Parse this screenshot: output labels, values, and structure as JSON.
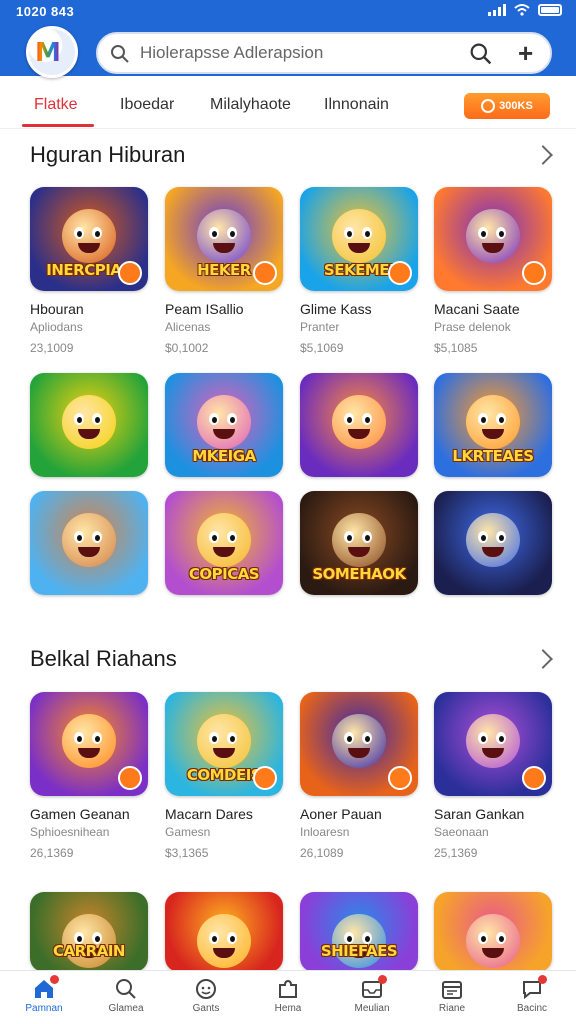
{
  "status": {
    "time": "1020 843"
  },
  "search": {
    "placeholder": "Hiolerapsse Adlerapsion"
  },
  "tabs": [
    {
      "label": "Flatke"
    },
    {
      "label": "Iboedar"
    },
    {
      "label": "Milalyhaote"
    },
    {
      "label": "Ilnnonain"
    }
  ],
  "coins": {
    "label": "300KS"
  },
  "sections": [
    {
      "title": "Hguran Hiburan",
      "apps": [
        {
          "tile_text": "INERCPIAS",
          "name": "Hbouran",
          "sub": "Apliodans",
          "num": "23,1009",
          "colors": [
            "#2a2f8a",
            "#d95b1a"
          ]
        },
        {
          "tile_text": "HEKER",
          "name": "Peam ISallio",
          "sub": "Alicenas",
          "num": "$0,1002",
          "colors": [
            "#f5a623",
            "#6a3bd1"
          ]
        },
        {
          "tile_text": "SEKEMEI",
          "name": "Glime Kass",
          "sub": "Pranter",
          "num": "$5,1069",
          "colors": [
            "#1aa3e8",
            "#f2c12e"
          ]
        },
        {
          "tile_text": "",
          "name": "Macani Saate",
          "sub": "Prase delenok",
          "num": "$5,1085",
          "colors": [
            "#ff7a2f",
            "#7b2fbf"
          ]
        },
        {
          "tile_text": "",
          "colors": [
            "#23a33a",
            "#f4d10f"
          ]
        },
        {
          "tile_text": "MKEIGA",
          "colors": [
            "#1e90e0",
            "#e061b8"
          ]
        },
        {
          "tile_text": "",
          "colors": [
            "#6a2bbf",
            "#ff8a3d"
          ]
        },
        {
          "tile_text": "LKRTEAES",
          "colors": [
            "#2e6fe0",
            "#ff9a2a"
          ]
        },
        {
          "tile_text": "",
          "colors": [
            "#4fb2f0",
            "#d4834a"
          ]
        },
        {
          "tile_text": "COPICAS",
          "colors": [
            "#b34fcf",
            "#f5b62a"
          ]
        },
        {
          "tile_text": "SOMEHAOK",
          "colors": [
            "#2b1a12",
            "#8a4a22"
          ]
        },
        {
          "tile_text": "",
          "colors": [
            "#1b1f4f",
            "#3f6be8"
          ]
        }
      ]
    },
    {
      "title": "Belkal Riahans",
      "apps": [
        {
          "tile_text": "",
          "name": "Gamen Geanan",
          "sub": "Sphioesnihean",
          "num": "26,1369",
          "colors": [
            "#7a2fc7",
            "#ff8a1f"
          ]
        },
        {
          "tile_text": "COMDEIS",
          "name": "Macarn Dares",
          "sub": "Gamesn",
          "num": "$3,1365",
          "colors": [
            "#2bb5e0",
            "#f3c133"
          ]
        },
        {
          "tile_text": "",
          "name": "Aoner Pauan",
          "sub": "Inloaresn",
          "num": "26,1089",
          "colors": [
            "#e8631a",
            "#3a2aa8"
          ]
        },
        {
          "tile_text": "",
          "name": "Saran Gankan",
          "sub": "Saeonaan",
          "num": "25,1369",
          "colors": [
            "#2a2f9a",
            "#b04fd9"
          ]
        },
        {
          "tile_text": "CARRAIN",
          "colors": [
            "#3c6e2a",
            "#c8842a"
          ]
        },
        {
          "tile_text": "",
          "colors": [
            "#d8261f",
            "#ffb020"
          ]
        },
        {
          "tile_text": "SHIEFAES",
          "colors": [
            "#8a3fd8",
            "#2a8ae8"
          ]
        },
        {
          "tile_text": "",
          "colors": [
            "#f6a32a",
            "#e85a8a"
          ]
        }
      ]
    }
  ],
  "bottom_nav": [
    {
      "label": "Pamnan",
      "icon": "home-icon",
      "active": true
    },
    {
      "label": "Glamea",
      "icon": "search-icon"
    },
    {
      "label": "Gants",
      "icon": "gamepad-icon"
    },
    {
      "label": "Hema",
      "icon": "puzzle-icon"
    },
    {
      "label": "Meulian",
      "icon": "inbox-icon"
    },
    {
      "label": "Riane",
      "icon": "calendar-icon"
    },
    {
      "label": "Bacinc",
      "icon": "chat-icon"
    }
  ]
}
